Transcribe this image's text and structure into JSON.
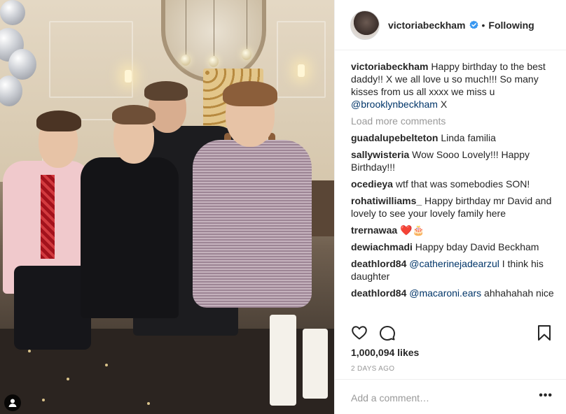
{
  "post": {
    "author": "victoriabeckham",
    "follow_label": "Following",
    "separator": "•"
  },
  "caption": {
    "username": "victoriabeckham",
    "text_before": " Happy birthday to the best daddy!! X we all love u so much!!! So many kisses from us all xxxx we miss u ",
    "mention": "@brooklynbeckham",
    "text_after": " X"
  },
  "load_more_label": "Load more comments",
  "comments": [
    {
      "user": "guadalupebelteton",
      "text": " Linda familia"
    },
    {
      "user": "sallywisteria",
      "text": " Wow Sooo Lovely!!! Happy Birthday!!!"
    },
    {
      "user": "ocedieya",
      "text": " wtf that was somebodies SON!"
    },
    {
      "user": "rohatiwilliams_",
      "text": " Happy birthday mr David and lovely to see your lovely family here"
    },
    {
      "user": "trernawaa",
      "text": " ❤️🎂"
    },
    {
      "user": "dewiachmadi",
      "text": " Happy bday David Beckham"
    },
    {
      "user": "deathlord84",
      "mention": " @catherinejadearzul",
      "text": " I think his daughter"
    },
    {
      "user": "deathlord84",
      "mention": " @macaroni.ears",
      "text": " ahhahahah nice"
    }
  ],
  "likes_label": "1,000,094 likes",
  "time_ago": "2 DAYS AGO",
  "comment_placeholder": "Add a comment…",
  "more_label": "•••",
  "icons": {
    "like": "heart-icon",
    "comment": "comment-bubble-icon",
    "save": "bookmark-icon",
    "verified": "verified-badge-icon",
    "user_tag": "user-tag-icon"
  },
  "colors": {
    "text": "#262626",
    "muted": "#999999",
    "mention": "#003569",
    "verified": "#3897f0",
    "border": "#efefef"
  }
}
